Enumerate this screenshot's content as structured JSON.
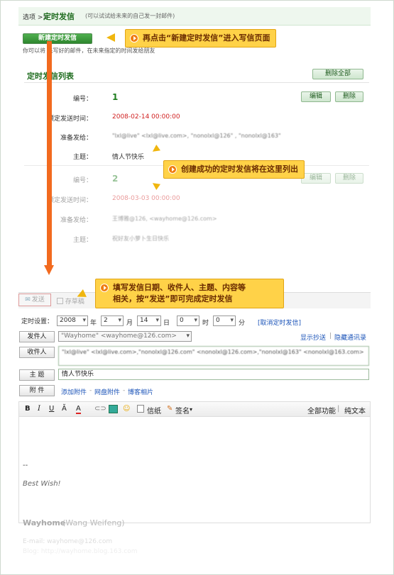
{
  "header": {
    "crumb": "选项 >>",
    "title": "定时发信",
    "hint": "(可以试试给未来的自己发一封邮件)"
  },
  "new_button": "新建定时发信",
  "intro": "你可以将  先写好的邮件，在未来指定的时间发给朋友",
  "callouts": {
    "c1": "再点击“新建定时发信”进入写信页面",
    "c2": "创建成功的定时发信将在这里列出",
    "c3_line1": "填写发信日期、收件人、主题、内容等",
    "c3_line2": "相关，按“发送”即可完成定时发信"
  },
  "list": {
    "title": "定时发信列表",
    "delete_all": "删除全部",
    "labels": {
      "num": "编号：",
      "time": "预定发送时间：",
      "to": "准备发给：",
      "subject": "主题："
    },
    "edit": "编辑",
    "delete": "删除",
    "items": [
      {
        "num": "1",
        "time": "2008-02-14 00:00:00",
        "to": "\"lxl@live\" <lxl@live.com>, \"nonolxl@126\" , \"nonolxl@163\"",
        "subject": "情人节快乐"
      },
      {
        "num": "2",
        "time": "2008-03-03 00:00:00",
        "to": "王博雅@126, <wayhome@126.com>",
        "subject": "祝好友小萝卜生日快乐"
      }
    ]
  },
  "compose": {
    "send": "发送",
    "draft": "存草稿",
    "schedule_label": "定时设置：",
    "year": "2008",
    "year_unit": "年",
    "month": "2",
    "month_unit": "月",
    "day": "14",
    "day_unit": "日",
    "hour": "0",
    "hour_unit": "时",
    "minute": "0",
    "minute_unit": "分",
    "cancel": "[取消定时发信]",
    "sender_btn": "发件人",
    "sender": "\"Wayhome\" <wayhome@126.com>",
    "show_cc": "显示抄送",
    "hide_contacts": "隐藏通讯录",
    "to_btn": "收件人",
    "to": "\"lxl@live\" <lxl@live.com>,\"nonolxl@126.com\" <nonolxl@126.com>,\"nonolxl@163\" <nonolxl@163.com>",
    "subject_btn": "主  题",
    "subject": "情人节快乐",
    "attach_btn": "附  件",
    "attach_link": "添加附件",
    "netdisk_link": "网盘附件",
    "blog_link": "博客相片",
    "toolbar": {
      "bold": "B",
      "italic": "I",
      "underline": "U",
      "font_size": "Ă",
      "color": "A",
      "paper": "信纸",
      "sign": "签名",
      "full": "全部功能",
      "plain": "纯文本"
    },
    "body": {
      "dash": "--",
      "wish": "Best Wish!",
      "name": "Wayhome",
      "fullname": "(Wang Weifeng)",
      "email": "E-mail: wayhome@126.com",
      "blog": "Blog: http://wayhome.blog.163.com"
    }
  }
}
